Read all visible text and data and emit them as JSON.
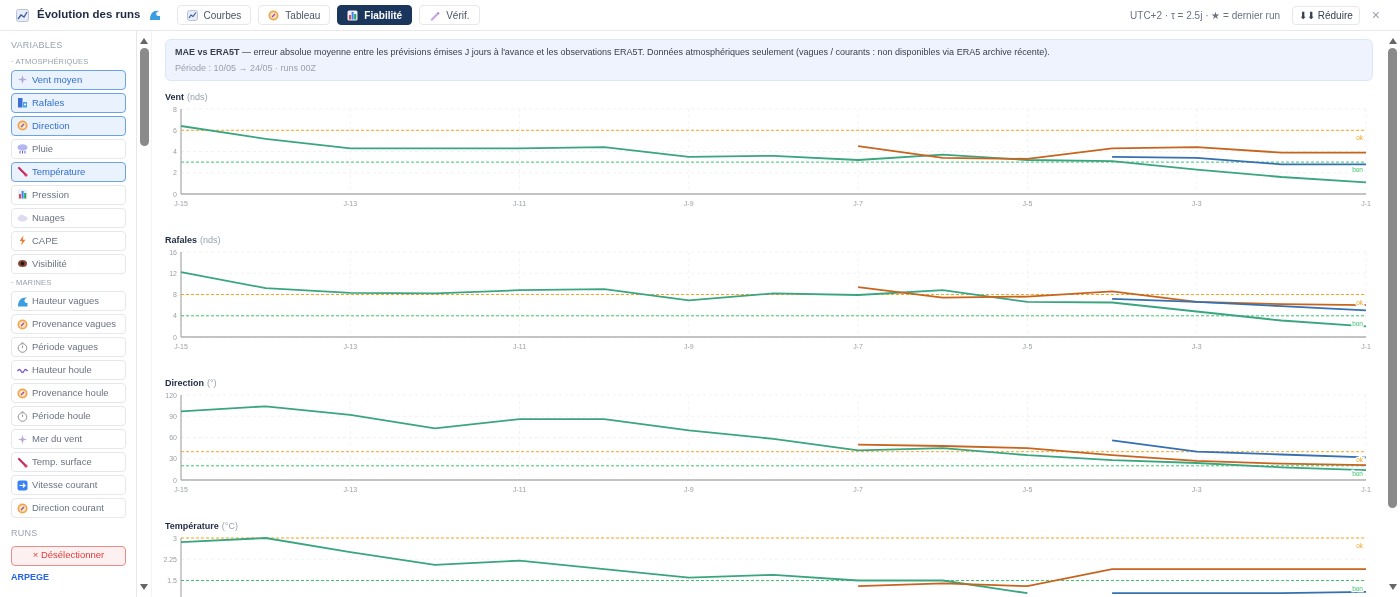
{
  "header": {
    "title": "Évolution des runs",
    "tabs": [
      {
        "label": "Courbes",
        "selected": false
      },
      {
        "label": "Tableau",
        "selected": false
      },
      {
        "label": "Fiabilité",
        "selected": true
      },
      {
        "label": "Vérif.",
        "selected": false
      }
    ],
    "info": "UTC+2 · τ = 2.5j · ★ = dernier run",
    "collapse_button": "⬇⬇ Réduire",
    "close": "×"
  },
  "sidebar": {
    "heading": "VARIABLES",
    "groups": [
      {
        "label": "· ATMOSPHÉRIQUES",
        "items": [
          {
            "label": "Vent moyen",
            "selected": true
          },
          {
            "label": "Rafales",
            "selected": true
          },
          {
            "label": "Direction",
            "selected": true
          },
          {
            "label": "Pluie",
            "selected": false
          },
          {
            "label": "Température",
            "selected": true
          },
          {
            "label": "Pression",
            "selected": false
          },
          {
            "label": "Nuages",
            "selected": false
          },
          {
            "label": "CAPE",
            "selected": false
          },
          {
            "label": "Visibilité",
            "selected": false
          }
        ]
      },
      {
        "label": "· MARINES",
        "items": [
          {
            "label": "Hauteur vagues",
            "selected": false
          },
          {
            "label": "Provenance vagues",
            "selected": false
          },
          {
            "label": "Période vagues",
            "selected": false
          },
          {
            "label": "Hauteur houle",
            "selected": false
          },
          {
            "label": "Provenance houle",
            "selected": false
          },
          {
            "label": "Période houle",
            "selected": false
          },
          {
            "label": "Mer du vent",
            "selected": false
          },
          {
            "label": "Temp. surface",
            "selected": false
          },
          {
            "label": "Vitesse courant",
            "selected": false
          },
          {
            "label": "Direction courant",
            "selected": false
          }
        ]
      }
    ],
    "runs_heading": "RUNS",
    "deselect_button": "× Désélectionner",
    "model": "ARPEGE"
  },
  "notice": {
    "text": "**MAE vs ERA5T** — erreur absolue moyenne entre les prévisions émises J jours à l'avance et les observations ERA5T. Données atmosphériques seulement (vagues / courants : non disponibles via ERA5 archive récente).",
    "period": "Période : 10/05 → 24/05 · runs 00Z"
  },
  "charts": [
    {
      "unit": "(nds)",
      "chart_data": {
        "type": "line",
        "title": "Vent",
        "categories": [
          "J-15",
          null,
          "J-13",
          null,
          "J-11",
          null,
          "J-9",
          null,
          "J-7",
          null,
          "J-5",
          null,
          "J-3",
          null,
          "J-1"
        ],
        "ylim": [
          0,
          8
        ],
        "yticks": [
          0,
          2,
          4,
          6,
          8
        ],
        "grid": true,
        "series": [
          {
            "name": "ok",
            "color": "#f5a524",
            "line_style": "dashed",
            "values": [
              6,
              6,
              6,
              6,
              6,
              6,
              6,
              6,
              6,
              6,
              6,
              6,
              6,
              6,
              6
            ]
          },
          {
            "name": "bon",
            "color": "#3cc46d",
            "line_style": "dashed",
            "values": [
              3,
              3,
              3,
              3,
              3,
              3,
              3,
              3,
              3,
              3,
              3,
              3,
              3,
              3,
              3
            ]
          },
          {
            "color": "#3aa57f",
            "values": [
              6.4,
              5.2,
              4.3,
              4.3,
              4.3,
              4.4,
              3.5,
              3.6,
              3.2,
              3.7,
              3.2,
              3.1,
              2.3,
              1.6,
              1.1
            ]
          },
          {
            "color": "#c6651f",
            "values": [
              null,
              null,
              null,
              null,
              null,
              null,
              null,
              null,
              4.5,
              3.4,
              3.3,
              4.3,
              4.4,
              3.9,
              3.9
            ]
          },
          {
            "color": "#3570b0",
            "values": [
              null,
              null,
              null,
              null,
              null,
              null,
              null,
              null,
              null,
              null,
              null,
              3.5,
              3.4,
              2.8,
              2.8
            ]
          }
        ]
      }
    },
    {
      "unit": "(nds)",
      "chart_data": {
        "type": "line",
        "title": "Rafales",
        "categories": [
          "J-15",
          null,
          "J-13",
          null,
          "J-11",
          null,
          "J-9",
          null,
          "J-7",
          null,
          "J-5",
          null,
          "J-3",
          null,
          "J-1"
        ],
        "ylim": [
          0,
          16
        ],
        "yticks": [
          0,
          4,
          8,
          12,
          16
        ],
        "grid": true,
        "series": [
          {
            "name": "ok",
            "color": "#f5a524",
            "line_style": "dashed",
            "values": [
              8,
              8,
              8,
              8,
              8,
              8,
              8,
              8,
              8,
              8,
              8,
              8,
              8,
              8,
              8
            ]
          },
          {
            "name": "bon",
            "color": "#3cc46d",
            "line_style": "dashed",
            "values": [
              4,
              4,
              4,
              4,
              4,
              4,
              4,
              4,
              4,
              4,
              4,
              4,
              4,
              4,
              4
            ]
          },
          {
            "color": "#3aa57f",
            "values": [
              12.2,
              9.2,
              8.3,
              8.2,
              8.8,
              9.0,
              6.9,
              8.2,
              7.9,
              8.8,
              6.6,
              6.5,
              4.8,
              3.1,
              2.0
            ]
          },
          {
            "color": "#c6651f",
            "values": [
              null,
              null,
              null,
              null,
              null,
              null,
              null,
              null,
              9.4,
              7.4,
              7.6,
              8.6,
              6.6,
              6.2,
              6.0
            ]
          },
          {
            "color": "#3570b0",
            "values": [
              null,
              null,
              null,
              null,
              null,
              null,
              null,
              null,
              null,
              null,
              null,
              7.2,
              6.6,
              5.8,
              5.0
            ]
          }
        ]
      }
    },
    {
      "unit": "(°)",
      "chart_data": {
        "type": "line",
        "title": "Direction",
        "categories": [
          "J-15",
          null,
          "J-13",
          null,
          "J-11",
          null,
          "J-9",
          null,
          "J-7",
          null,
          "J-5",
          null,
          "J-3",
          null,
          "J-1"
        ],
        "ylim": [
          0,
          120
        ],
        "yticks": [
          0,
          30,
          60,
          90,
          120
        ],
        "grid": true,
        "series": [
          {
            "name": "ok",
            "color": "#f5a524",
            "line_style": "dashed",
            "values": [
              40,
              40,
              40,
              40,
              40,
              40,
              40,
              40,
              40,
              40,
              40,
              40,
              40,
              40,
              40
            ]
          },
          {
            "name": "bon",
            "color": "#3cc46d",
            "line_style": "dashed",
            "values": [
              20,
              20,
              20,
              20,
              20,
              20,
              20,
              20,
              20,
              20,
              20,
              20,
              20,
              20,
              20
            ]
          },
          {
            "color": "#3aa57f",
            "values": [
              97,
              104,
              92,
              73,
              86,
              86,
              70,
              58,
              42,
              45,
              35,
              28,
              24,
              18,
              14
            ]
          },
          {
            "color": "#c6651f",
            "values": [
              null,
              null,
              null,
              null,
              null,
              null,
              null,
              null,
              50,
              48,
              45,
              35,
              27,
              23,
              21
            ]
          },
          {
            "color": "#3570b0",
            "values": [
              null,
              null,
              null,
              null,
              null,
              null,
              null,
              null,
              null,
              null,
              null,
              56,
              40,
              36,
              32
            ]
          }
        ]
      }
    },
    {
      "unit": "(°C)",
      "chart_data": {
        "type": "line",
        "title": "Température",
        "categories": [
          null,
          null,
          null,
          null,
          null,
          null,
          null,
          null,
          null,
          null,
          null,
          null,
          null,
          null,
          null
        ],
        "ylim": [
          0,
          3
        ],
        "yticks": [
          1.5,
          2.25,
          3
        ],
        "grid": true,
        "series": [
          {
            "name": "ok",
            "color": "#f5a524",
            "line_style": "dashed",
            "values": [
              3,
              3,
              3,
              3,
              3,
              3,
              3,
              3,
              3,
              3,
              3,
              3,
              3,
              3,
              3
            ]
          },
          {
            "name": "bon",
            "color": "#3cc46d",
            "line_style": "dashed",
            "values": [
              1.5,
              1.5,
              1.5,
              1.5,
              1.5,
              1.5,
              1.5,
              1.5,
              1.5,
              1.5,
              1.5,
              1.5,
              1.5,
              1.5,
              1.5
            ]
          },
          {
            "color": "#3aa57f",
            "values": [
              2.85,
              3.0,
              2.5,
              2.05,
              2.2,
              1.9,
              1.6,
              1.7,
              1.5,
              1.5,
              1.05,
              null,
              null,
              null,
              null
            ]
          },
          {
            "color": "#c6651f",
            "values": [
              null,
              null,
              null,
              null,
              null,
              null,
              null,
              null,
              1.3,
              1.4,
              1.3,
              1.9,
              1.9,
              1.9,
              1.9
            ]
          },
          {
            "color": "#3570b0",
            "values": [
              null,
              null,
              null,
              null,
              null,
              null,
              null,
              null,
              null,
              null,
              null,
              1.05,
              1.05,
              1.05,
              1.1
            ]
          }
        ]
      }
    }
  ]
}
